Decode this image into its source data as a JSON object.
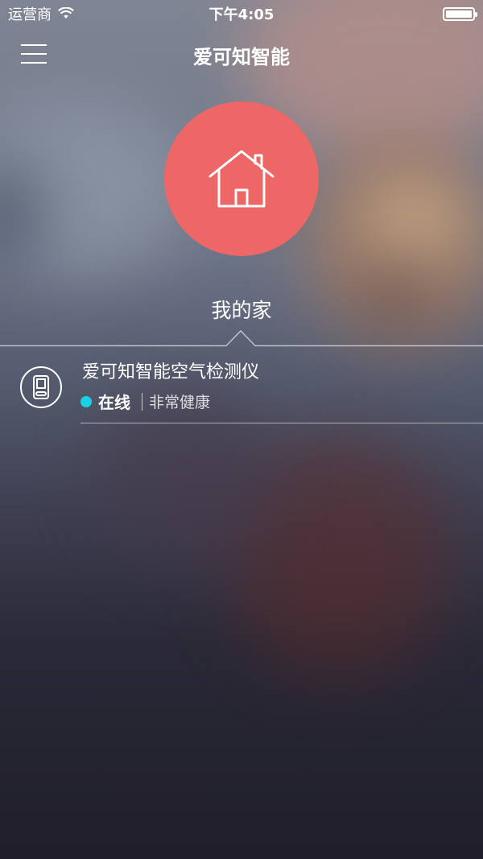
{
  "statusbar": {
    "carrier": "运营商",
    "time": "下午4:05",
    "battery_level": 1.0
  },
  "header": {
    "title": "爱可知智能",
    "menu_icon": "menu-icon"
  },
  "home": {
    "icon": "house-icon",
    "label": "我的家",
    "circle_color": "#ec6766"
  },
  "devices": [
    {
      "icon": "air-monitor-icon",
      "name": "爱可知智能空气检测仪",
      "status": "在线",
      "status_color": "#19d2e6",
      "air_quality": "非常健康"
    }
  ]
}
